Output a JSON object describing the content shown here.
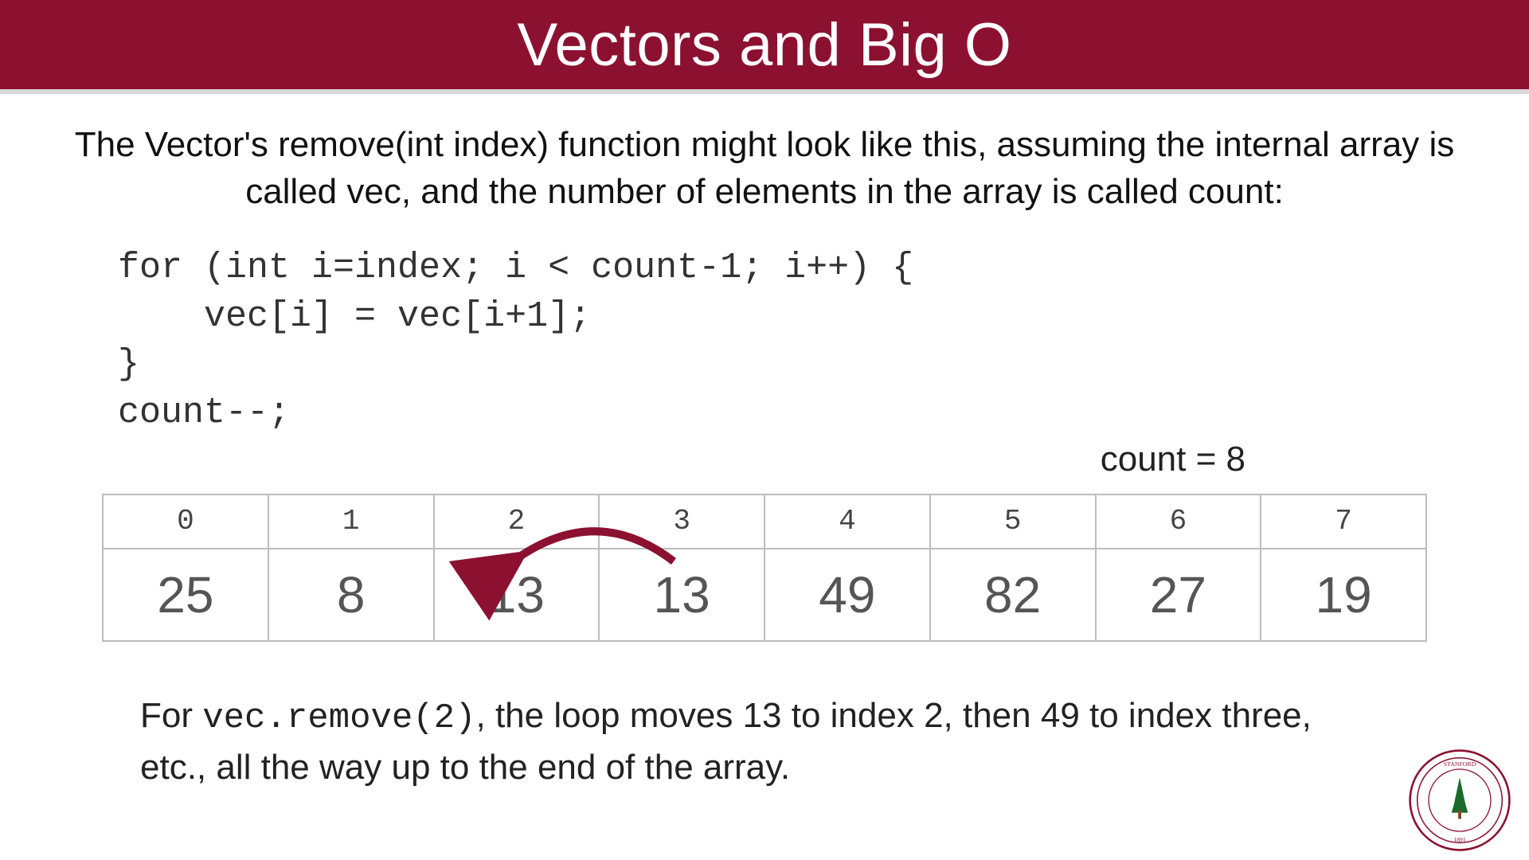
{
  "title": "Vectors and Big O",
  "intro": "The Vector's remove(int index) function might look like this, assuming the internal array is called vec, and the number of elements in the array is called count:",
  "code": "for (int i=index; i < count-1; i++) {\n    vec[i] = vec[i+1];\n}\ncount--;",
  "count_label": "count = 8",
  "array": {
    "indices": [
      "0",
      "1",
      "2",
      "3",
      "4",
      "5",
      "6",
      "7"
    ],
    "values": [
      "25",
      "8",
      "13",
      "13",
      "49",
      "82",
      "27",
      "19"
    ]
  },
  "explain": {
    "prefix": "For ",
    "mono": "vec.remove(2)",
    "suffix": ", the loop moves 13 to index 2, then 49 to index three, etc., all the way up to the end of the array."
  },
  "colors": {
    "header_bg": "#8c1130",
    "arrow": "#8c1130"
  },
  "seal_alt": "Stanford University seal"
}
